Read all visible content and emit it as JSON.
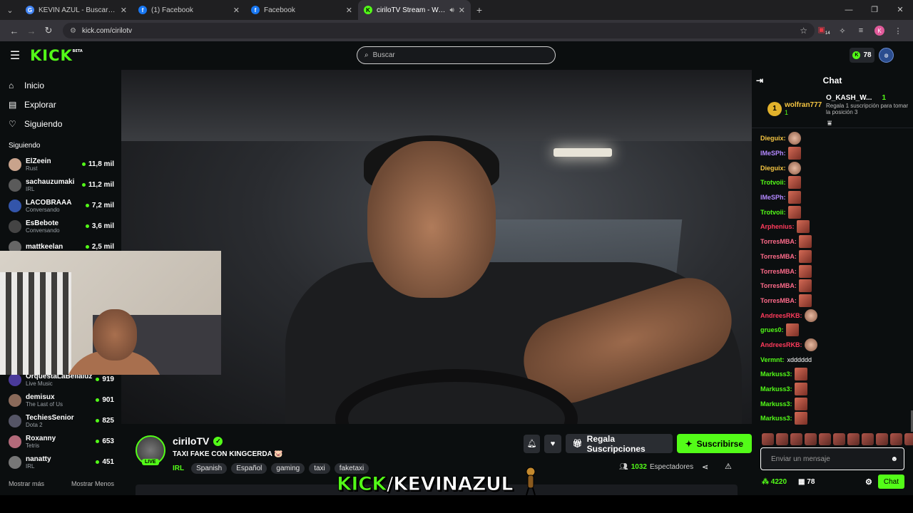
{
  "browser": {
    "tabs": [
      {
        "title": "KEVIN AZUL - Buscar con Google",
        "favicon": "G",
        "favicon_color": "#4285f4",
        "active": false
      },
      {
        "title": "(1) Facebook",
        "favicon": "f",
        "favicon_color": "#1877f2",
        "active": false
      },
      {
        "title": "Facebook",
        "favicon": "f",
        "favicon_color": "#1877f2",
        "active": false
      },
      {
        "title": "ciriloTV Stream - Watch Live",
        "favicon": "K",
        "favicon_color": "#53fc18",
        "active": true
      }
    ],
    "url": "kick.com/cirilotv",
    "extension_badge": "14",
    "profile_initial": "K"
  },
  "header": {
    "logo": "KICK",
    "logo_badge": "BETA",
    "search_placeholder": "Buscar",
    "kick_points": "78"
  },
  "sidebar": {
    "nav": [
      {
        "label": "Inicio",
        "icon": "home-icon",
        "glyph": "⌂"
      },
      {
        "label": "Explorar",
        "icon": "browse-icon",
        "glyph": "▤"
      },
      {
        "label": "Siguiendo",
        "icon": "heart-icon",
        "glyph": "♡"
      }
    ],
    "following_title": "Siguiendo",
    "following_top": [
      {
        "name": "ElZeein",
        "category": "Rust",
        "viewers": "11,8 mil",
        "color": "#c9a38c"
      },
      {
        "name": "sachauzumaki",
        "category": "IRL",
        "viewers": "11,2 mil",
        "color": "#5a5a5a"
      },
      {
        "name": "LACOBRAAA",
        "category": "Conversando",
        "viewers": "7,2 mil",
        "color": "#3355aa"
      },
      {
        "name": "EsBebote",
        "category": "Conversando",
        "viewers": "3,6 mil",
        "color": "#444"
      },
      {
        "name": "mattkeelan",
        "category": "",
        "viewers": "2,5 mil",
        "color": "#666"
      }
    ],
    "following_bottom": [
      {
        "name": "OrquestaLaBellaluz",
        "category": "Live Music",
        "viewers": "919",
        "color": "#4a3a9a"
      },
      {
        "name": "demisux",
        "category": "The Last of Us",
        "viewers": "901",
        "color": "#8a6a5a"
      },
      {
        "name": "TechiesSenior",
        "category": "Dota 2",
        "viewers": "825",
        "color": "#556"
      },
      {
        "name": "Roxanny",
        "category": "Tetris",
        "viewers": "653",
        "color": "#b36a7a"
      },
      {
        "name": "nanatty",
        "category": "IRL",
        "viewers": "451",
        "color": "#777"
      }
    ],
    "show_more": "Mostrar más",
    "show_less": "Mostrar Menos"
  },
  "stream": {
    "channel": "ciriloTV",
    "live_label": "LIVE",
    "title": "TAXI FAKE CON KINGCERDA 🐷",
    "category": "IRL",
    "tags": [
      "Spanish",
      "Español",
      "gaming",
      "taxi",
      "faketaxi"
    ],
    "viewer_count": "1032",
    "viewer_label": "Espectadores",
    "gift_label": "Regala Suscripciones",
    "subscribe_label": "Suscribirse"
  },
  "watermark": {
    "part1": "KICK",
    "part2": "/KEVINAZUL"
  },
  "chat": {
    "title": "Chat",
    "pinned_left": {
      "rank": "1",
      "name": "wolfran777",
      "count": "1"
    },
    "pinned_right": {
      "name": "O_KASH_W...",
      "count": "1",
      "desc": "Regala 1 suscripción para tomar la posición 3"
    },
    "messages": [
      {
        "user": "Dieguix:",
        "color": "#f5c542",
        "text": "",
        "emote": "round"
      },
      {
        "user": "IMeSPh:",
        "color": "#b388ff",
        "text": "",
        "emote": "square"
      },
      {
        "user": "Dieguix:",
        "color": "#f5c542",
        "text": "",
        "emote": "round"
      },
      {
        "user": "Trotvoii:",
        "color": "#53fc18",
        "text": "",
        "emote": "square"
      },
      {
        "user": "IMeSPh:",
        "color": "#b388ff",
        "text": "",
        "emote": "square"
      },
      {
        "user": "Trotvoii:",
        "color": "#53fc18",
        "text": "",
        "emote": "square"
      },
      {
        "user": "Arphenius:",
        "color": "#ff3b5c",
        "text": "",
        "emote": "square"
      },
      {
        "user": "TorresMBA:",
        "color": "#ff6b8a",
        "text": "",
        "emote": "square"
      },
      {
        "user": "TorresMBA:",
        "color": "#ff6b8a",
        "text": "",
        "emote": "square"
      },
      {
        "user": "TorresMBA:",
        "color": "#ff6b8a",
        "text": "",
        "emote": "square"
      },
      {
        "user": "TorresMBA:",
        "color": "#ff6b8a",
        "text": "",
        "emote": "square"
      },
      {
        "user": "TorresMBA:",
        "color": "#ff6b8a",
        "text": "",
        "emote": "square"
      },
      {
        "user": "AndreesRKB:",
        "color": "#ff3b5c",
        "text": "",
        "emote": "round"
      },
      {
        "user": "grues0:",
        "color": "#53fc18",
        "text": "",
        "emote": "square"
      },
      {
        "user": "AndreesRKB:",
        "color": "#ff3b5c",
        "text": "",
        "emote": "round"
      },
      {
        "user": "Vermnt:",
        "color": "#53fc18",
        "text": "xdddddd",
        "emote": ""
      },
      {
        "user": "Markuss3:",
        "color": "#53fc18",
        "text": "",
        "emote": "square"
      },
      {
        "user": "Markuss3:",
        "color": "#53fc18",
        "text": "",
        "emote": "square"
      },
      {
        "user": "Markuss3:",
        "color": "#53fc18",
        "text": "",
        "emote": "square"
      },
      {
        "user": "Markuss3:",
        "color": "#53fc18",
        "text": "",
        "emote": "square"
      }
    ],
    "input_placeholder": "Enviar un mensaje",
    "points": "4220",
    "gift_count": "78",
    "send_label": "Chat"
  }
}
